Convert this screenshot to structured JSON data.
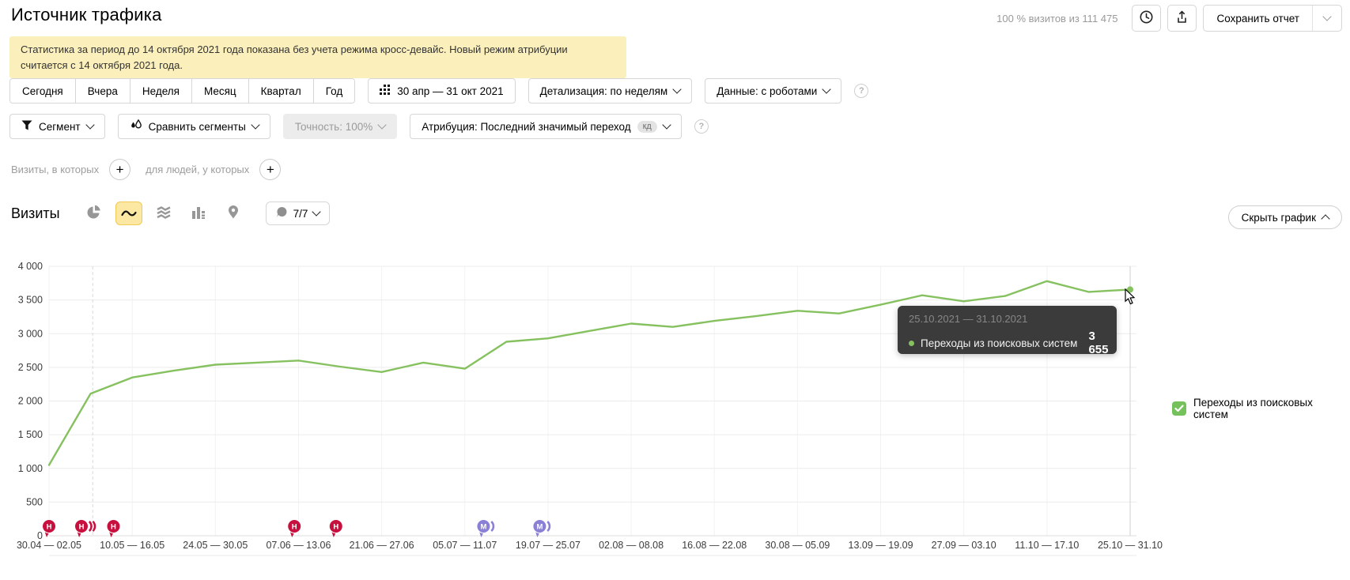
{
  "header": {
    "title": "Источник трафика",
    "visits_summary": "100 % визитов из 111 475",
    "save_report": "Сохранить отчет"
  },
  "notice": "Статистика за период до 14 октября 2021 года показана без учета режима кросс-девайс. Новый режим атрибуции считается с 14 октября 2021 года.",
  "period_tabs": [
    "Сегодня",
    "Вчера",
    "Неделя",
    "Месяц",
    "Квартал",
    "Год"
  ],
  "controls": {
    "date_range": "30 апр — 31 окт 2021",
    "detail": "Детализация: по неделям",
    "data_mode": "Данные: с роботами",
    "segment": "Сегмент",
    "compare": "Сравнить сегменты",
    "accuracy": "Точность: 100%",
    "attribution": "Атрибуция: Последний значимый переход",
    "attribution_badge": "кд"
  },
  "filters": {
    "visits": "Визиты, в которых",
    "people": "для людей, у которых"
  },
  "metric": {
    "title": "Визиты",
    "annotations_count": "7/7",
    "hide_chart": "Скрыть график"
  },
  "tooltip": {
    "date_range": "25.10.2021 — 31.10.2021",
    "series": "Переходы из поисковых систем",
    "value": "3 655"
  },
  "legend": {
    "label": "Переходы из поисковых систем",
    "checked": true
  },
  "icons": {
    "plus": "+",
    "help": "?"
  },
  "colors": {
    "line_green": "#86c160",
    "legend_green": "#75c25c",
    "accent_yellow_bg": "#fce8a2",
    "accent_yellow_border": "#f0c957",
    "banner_yellow": "#fbefbb",
    "holiday_red": "#c8103e",
    "event_purple": "#8a80d6",
    "tooltip_bg": "#3b3b3b"
  },
  "chart_data": {
    "type": "line",
    "title": "Визиты",
    "ylim": [
      0,
      4000
    ],
    "y_tick_labels": [
      "0",
      "500",
      "1 000",
      "1 500",
      "2 000",
      "2 500",
      "3 000",
      "3 500",
      "4 000"
    ],
    "x_tick_labels": [
      "30.04 — 02.05",
      "10.05 — 16.05",
      "24.05 — 30.05",
      "07.06 — 13.06",
      "21.06 — 27.06",
      "05.07 — 11.07",
      "19.07 — 25.07",
      "02.08 — 08.08",
      "16.08 — 22.08",
      "30.08 — 05.09",
      "13.09 — 19.09",
      "27.09 — 03.10",
      "11.10 — 17.10",
      "25.10 — 31.10"
    ],
    "x_tick_every": 2,
    "grid": true,
    "legend_position": "right",
    "series": [
      {
        "name": "Переходы из поисковых систем",
        "color": "#86c160",
        "values": [
          1050,
          2110,
          2350,
          2450,
          2540,
          2570,
          2600,
          2510,
          2430,
          2570,
          2480,
          2880,
          2930,
          3040,
          3150,
          3100,
          3190,
          3260,
          3340,
          3300,
          3430,
          3570,
          3480,
          3560,
          3780,
          3620,
          3655
        ]
      }
    ],
    "hovered_point": {
      "index": 26,
      "value_label": "3 655"
    },
    "dashed_line_week": 1.05,
    "event_markers": [
      {
        "label": "Н",
        "week": 0.0,
        "stack": 1,
        "color": "#c8103e"
      },
      {
        "label": "Н",
        "week": 0.78,
        "stack": 3,
        "color": "#c8103e"
      },
      {
        "label": "Н",
        "week": 1.55,
        "stack": 1,
        "color": "#c8103e"
      },
      {
        "label": "Н",
        "week": 5.9,
        "stack": 1,
        "color": "#c8103e"
      },
      {
        "label": "Н",
        "week": 6.9,
        "stack": 1,
        "color": "#c8103e"
      },
      {
        "label": "М",
        "week": 10.45,
        "stack": 2,
        "color": "#8a80d6"
      },
      {
        "label": "М",
        "week": 11.8,
        "stack": 2,
        "color": "#8a80d6"
      }
    ]
  }
}
